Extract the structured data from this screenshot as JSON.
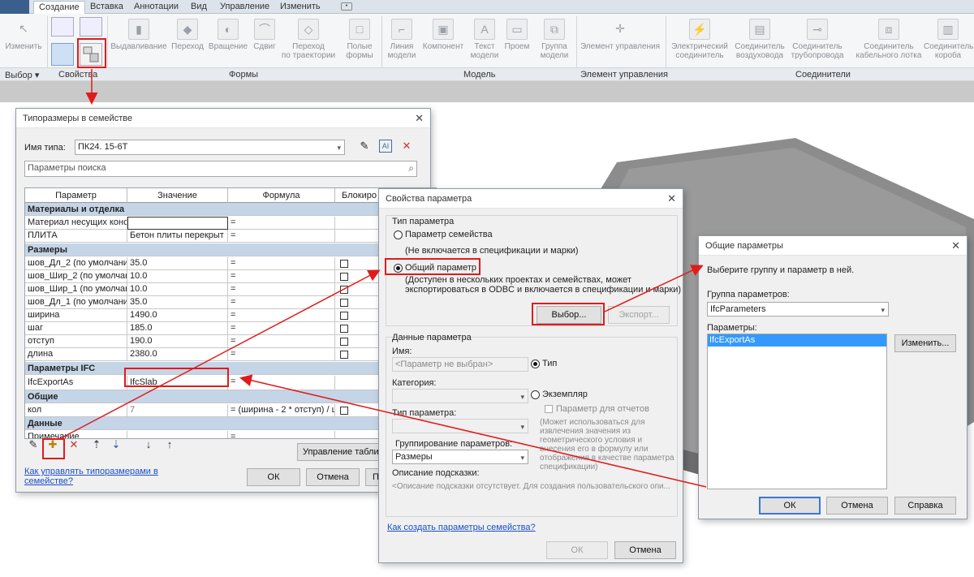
{
  "ribbon": {
    "tabs": [
      "Создание",
      "Вставка",
      "Аннотации",
      "Вид",
      "Управление",
      "Изменить"
    ],
    "buttons": {
      "modify": "Изменить",
      "extrusion": "Выдавливание",
      "blend": "Переход",
      "revolve": "Вращение",
      "sweep": "Сдвиг",
      "sweep_blend_1": "Переход",
      "sweep_blend_2": "по траектории",
      "void_1": "Полые",
      "void_2": "формы",
      "model_line_1": "Линия",
      "model_line_2": "модели",
      "component": "Компонент",
      "model_text_1": "Текст",
      "model_text_2": "модели",
      "opening": "Проем",
      "model_group_1": "Группа",
      "model_group_2": "модели",
      "control": "Элемент управления",
      "electrical_1": "Электрический",
      "electrical_2": "соединитель",
      "duct_1": "Соединитель",
      "duct_2": "воздуховода",
      "pipe_1": "Соединитель",
      "pipe_2": "трубопровода",
      "cable_1": "Соединитель",
      "cable_2": "кабельного лотка",
      "conduit_1": "Соединитель",
      "conduit_2": "короба"
    },
    "panels": {
      "select": "Выбор",
      "properties": "Свойства",
      "forms": "Формы",
      "model": "Модель",
      "control": "Элемент управления",
      "connectors": "Соединители"
    }
  },
  "family_types": {
    "title": "Типоразмеры в семействе",
    "type_name_label": "Имя типа:",
    "type_name_value": "ПК24. 15-6Т",
    "search_placeholder": "Параметры поиска",
    "columns": [
      "Параметр",
      "Значение",
      "Формула",
      "Блокиро"
    ],
    "sections": {
      "materials": "Материалы и отделка",
      "dimensions": "Размеры",
      "ifc": "Параметры IFC",
      "general": "Общие",
      "data": "Данные"
    },
    "rows": {
      "material_name": "Материал несущих конст",
      "material_value": "",
      "plita_name": "ПЛИТА",
      "plita_value": "Бетон плиты перекрыт",
      "d1_name": "шов_Дл_2 (по умолчани",
      "d1_value": "35.0",
      "d2_name": "шов_Шир_2 (по умолчани",
      "d2_value": "10.0",
      "d3_name": "шов_Шир_1 (по умолчани",
      "d3_value": "10.0",
      "d4_name": "шов_Дл_1 (по умолчани",
      "d4_value": "35.0",
      "d5_name": "ширина",
      "d5_value": "1490.0",
      "d6_name": "шаг",
      "d6_value": "185.0",
      "d7_name": "отступ",
      "d7_value": "190.0",
      "d8_name": "длина",
      "d8_value": "2380.0",
      "ifc_name": "IfcExportAs",
      "ifc_value": "IfcSlab",
      "kol_name": "кол",
      "kol_value": "7",
      "kol_formula": "= (ширина - 2 * отступ) / ш",
      "note_name": "Примечание"
    },
    "eq": "=",
    "manage_tables": "Управление таблица",
    "help_link_1": "Как управлять типоразмерами в",
    "help_link_2": "семействе?",
    "ok": "ОК",
    "cancel": "Отмена",
    "apply_partial": "П"
  },
  "param_props": {
    "title": "Свойства параметра",
    "param_type_group": "Тип параметра",
    "family_param": "Параметр семейства",
    "family_param_desc": "(Не включается в спецификации и марки)",
    "shared_param": "Общий параметр",
    "shared_param_desc_1": "(Доступен в нескольких проектах и семействах, может",
    "shared_param_desc_2": "экспортироваться в ODBC и включается в спецификации и марки)",
    "select_btn": "Выбор...",
    "export_btn": "Экспорт...",
    "data_group": "Данные параметра",
    "name_label": "Имя:",
    "name_placeholder": "<Параметр не выбран>",
    "type_radio": "Тип",
    "category_label": "Категория:",
    "instance_radio": "Экземпляр",
    "report_param": "Параметр для отчетов",
    "report_desc": "(Может использоваться для извлечения значения из геометрического условия и внесения его в формулу или отображения в качестве параметра спецификации)",
    "param_type_label": "Тип параметра:",
    "grouping_label": "Группирование параметров:",
    "grouping_value": "Размеры",
    "tooltip_label": "Описание подсказки:",
    "tooltip_value": "<Описание подсказки отсутствует. Для создания пользовательского опи...",
    "help_link": "Как создать параметры семейства?",
    "ok": "ОК",
    "cancel": "Отмена"
  },
  "shared_params": {
    "title": "Общие параметры",
    "instruction": "Выберите группу и параметр в ней.",
    "group_label": "Группа параметров:",
    "group_value": "IfcParameters",
    "params_label": "Параметры:",
    "params": [
      "IfcExportAs"
    ],
    "edit_btn": "Изменить...",
    "ok": "ОК",
    "cancel": "Отмена",
    "help": "Справка"
  },
  "colors": {
    "highlight": "#e01b1b",
    "section_row": "#c5d5e8",
    "selection": "#3399ff"
  }
}
